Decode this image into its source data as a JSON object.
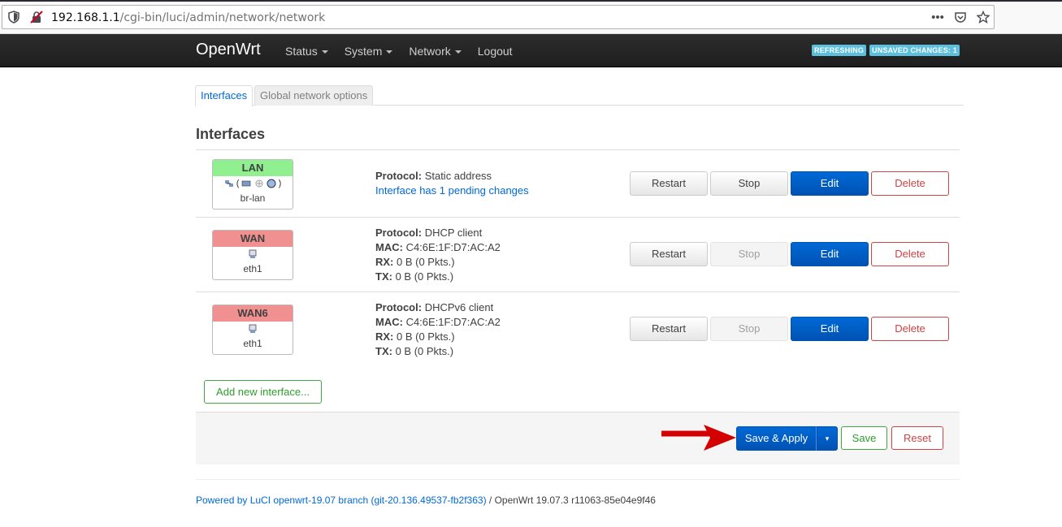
{
  "browser": {
    "url_host": "192.168.1.1",
    "url_path": "/cgi-bin/luci/admin/network/network",
    "icons": [
      "shield-icon",
      "insecure-lock-icon",
      "more-icon",
      "pocket-icon",
      "bookmark-star-icon"
    ]
  },
  "header": {
    "brand": "OpenWrt",
    "nav": [
      {
        "label": "Status",
        "dropdown": true
      },
      {
        "label": "System",
        "dropdown": true
      },
      {
        "label": "Network",
        "dropdown": true
      },
      {
        "label": "Logout",
        "dropdown": false
      }
    ],
    "badges": [
      "REFRESHING",
      "UNSAVED CHANGES: 1"
    ],
    "badge_color": "#5bc0de",
    "bar_color": "#242424"
  },
  "tabs": [
    {
      "label": "Interfaces",
      "active": true
    },
    {
      "label": "Global network options",
      "active": false
    }
  ],
  "section_title": "Interfaces",
  "interfaces": [
    {
      "name": "LAN",
      "status_color": "#90f090",
      "device_icons": "(🖧🖧🖧)",
      "device": "br-lan",
      "protocol_label": "Protocol:",
      "protocol": "Static address",
      "pending": "Interface has 1 pending changes",
      "buttons": {
        "restart": "Restart",
        "stop": "Stop",
        "edit": "Edit",
        "delete": "Delete"
      },
      "stop_disabled": false
    },
    {
      "name": "WAN",
      "status_color": "#f09090",
      "device": "eth1",
      "protocol_label": "Protocol:",
      "protocol": "DHCP client",
      "mac_label": "MAC:",
      "mac": "C4:6E:1F:D7:AC:A2",
      "rx_label": "RX:",
      "rx": "0 B (0 Pkts.)",
      "tx_label": "TX:",
      "tx": "0 B (0 Pkts.)",
      "buttons": {
        "restart": "Restart",
        "stop": "Stop",
        "edit": "Edit",
        "delete": "Delete"
      },
      "stop_disabled": true
    },
    {
      "name": "WAN6",
      "status_color": "#f09090",
      "device": "eth1",
      "protocol_label": "Protocol:",
      "protocol": "DHCPv6 client",
      "mac_label": "MAC:",
      "mac": "C4:6E:1F:D7:AC:A2",
      "rx_label": "RX:",
      "rx": "0 B (0 Pkts.)",
      "tx_label": "TX:",
      "tx": "0 B (0 Pkts.)",
      "buttons": {
        "restart": "Restart",
        "stop": "Stop",
        "edit": "Edit",
        "delete": "Delete"
      },
      "stop_disabled": true
    }
  ],
  "add_interface": "Add new interface...",
  "action_bar": {
    "save_apply": "Save & Apply",
    "dropdown_caret": "▾",
    "save": "Save",
    "reset": "Reset"
  },
  "annotation": {
    "arrow_color": "#d40000"
  },
  "footer": {
    "link": "Powered by LuCI openwrt-19.07 branch (git-20.136.49537-fb2f363)",
    "text": " / OpenWrt 19.07.3 r11063-85e04e9f46"
  }
}
